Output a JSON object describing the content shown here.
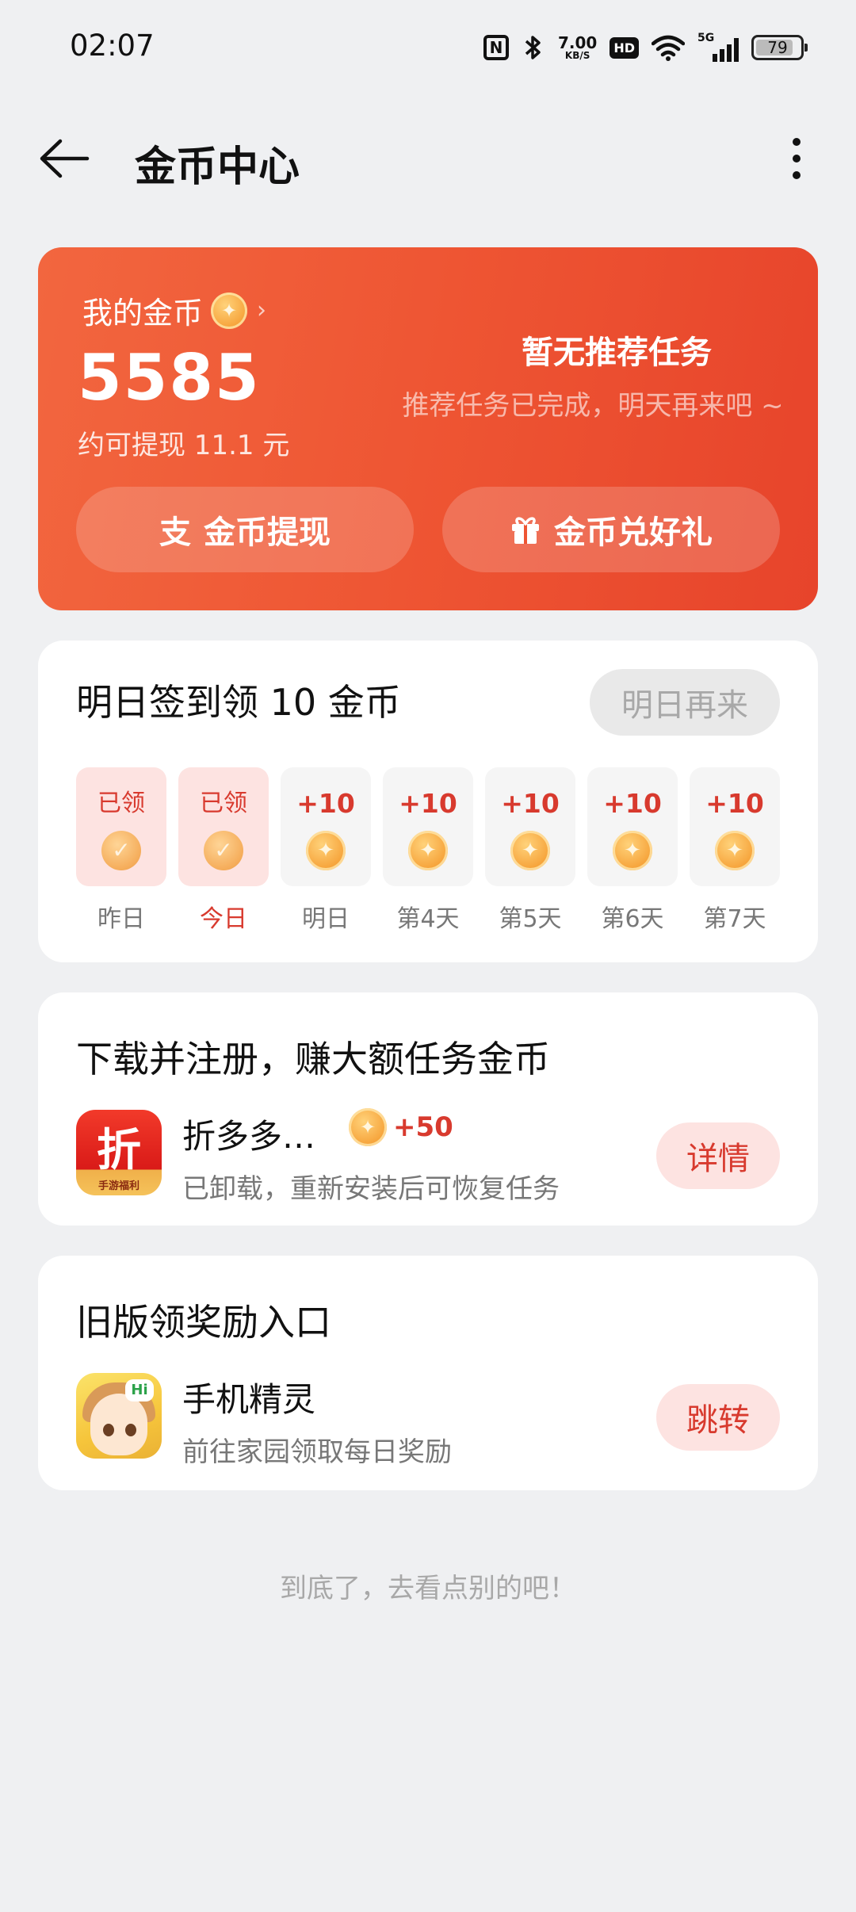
{
  "status_bar": {
    "time": "02:07",
    "net_speed_value": "7.00",
    "net_speed_unit": "KB/S",
    "hd_label": "HD",
    "network_label": "5G",
    "battery": "79"
  },
  "header": {
    "title": "金币中心"
  },
  "coin_card": {
    "label": "我的金币",
    "balance": "5585",
    "cash_estimate": "约可提现 11.1 元",
    "recommend_title": "暂无推荐任务",
    "recommend_sub": "推荐任务已完成，明天再来吧 ~",
    "withdraw_btn": "金币提现",
    "gift_btn": "金币兑好礼",
    "withdraw_icon_glyph": "支",
    "colors": {
      "card_start": "#f2663f",
      "card_end": "#e7442b"
    }
  },
  "signin": {
    "title": "明日签到领 10 金币",
    "button": "明日再来",
    "days": [
      {
        "amount": "已领",
        "label": "昨日",
        "state": "claimed"
      },
      {
        "amount": "已领",
        "label": "今日",
        "state": "claimed-today"
      },
      {
        "amount": "+10",
        "label": "明日",
        "state": "pending"
      },
      {
        "amount": "+10",
        "label": "第4天",
        "state": "pending"
      },
      {
        "amount": "+10",
        "label": "第5天",
        "state": "pending"
      },
      {
        "amount": "+10",
        "label": "第6天",
        "state": "pending"
      },
      {
        "amount": "+10",
        "label": "第7天",
        "state": "pending"
      }
    ]
  },
  "download_task": {
    "title": "下载并注册，赚大额任务金币",
    "app_name": "折多多…",
    "app_icon_char": "折",
    "app_icon_sub": "手游福利",
    "reward": "+50",
    "desc": "已卸载，重新安装后可恢复任务",
    "button": "详情"
  },
  "legacy": {
    "title": "旧版领奖励入口",
    "app_name": "手机精灵",
    "app_icon_badge": "Hi",
    "desc": "前往家园领取每日奖励",
    "button": "跳转"
  },
  "footer": "到底了，去看点别的吧！"
}
